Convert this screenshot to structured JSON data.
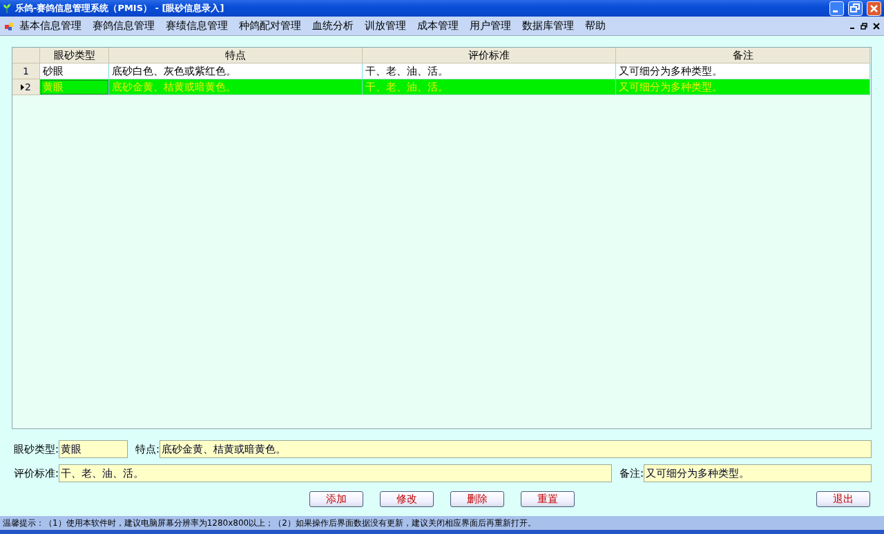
{
  "window": {
    "title": "乐鸽-赛鸽信息管理系统（PMIS） - [眼砂信息录入]"
  },
  "menu": [
    "基本信息管理",
    "赛鸽信息管理",
    "赛绩信息管理",
    "种鸽配对管理",
    "血统分析",
    "训放管理",
    "成本管理",
    "用户管理",
    "数据库管理",
    "帮助"
  ],
  "table": {
    "columns": [
      "眼砂类型",
      "特点",
      "评价标准",
      "备注"
    ],
    "rows": [
      {
        "number": "1",
        "selected": false,
        "cells": [
          "砂眼",
          "底砂白色、灰色或紫红色。",
          "干、老、油、活。",
          "又可细分为多种类型。"
        ]
      },
      {
        "number": "2",
        "selected": true,
        "cells": [
          "黄眼",
          "底砂金黄、桔黄或暗黄色。",
          "干、老、油、活。",
          "又可细分为多种类型。"
        ]
      }
    ]
  },
  "form": {
    "rows": [
      [
        {
          "label": "眼砂类型:",
          "value": "黄眼"
        },
        {
          "label": "特点:",
          "value": "底砂金黄、桔黄或暗黄色。"
        }
      ],
      [
        {
          "label": "评价标准:",
          "value": "干、老、油、活。"
        },
        {
          "label": "备注:",
          "value": "又可细分为多种类型。"
        }
      ]
    ]
  },
  "buttons": [
    "添加",
    "修改",
    "删除",
    "重置",
    "退出"
  ],
  "status_bar": "温馨提示：（1）使用本软件时，建议电脑屏幕分辨率为1280x800以上；（2）如果操作后界面数据没有更新，建议关闭相应界面后再重新打开。"
}
